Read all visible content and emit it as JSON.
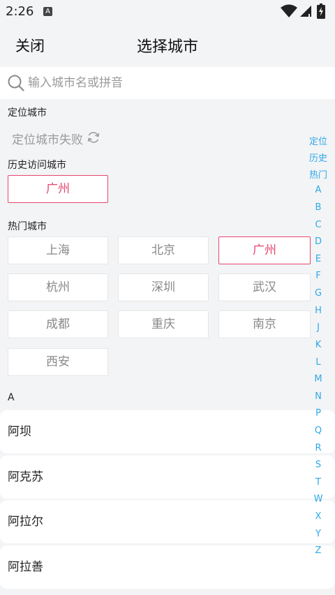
{
  "status": {
    "time": "2:26",
    "app_icon": "A",
    "icons": [
      "wifi-icon",
      "signal-icon",
      "battery-icon"
    ]
  },
  "nav": {
    "close_label": "关闭",
    "title": "选择城市"
  },
  "search": {
    "placeholder": "输入城市名或拼音",
    "value": ""
  },
  "location": {
    "label": "定位城市",
    "status_text": "定位城市失败"
  },
  "history": {
    "label": "历史访问城市",
    "cities": [
      "广州"
    ]
  },
  "hot": {
    "label": "热门城市",
    "cities": [
      "上海",
      "北京",
      "广州",
      "杭州",
      "深圳",
      "武汉",
      "成都",
      "重庆",
      "南京",
      "西安"
    ],
    "selected": "广州"
  },
  "list": {
    "header": "A",
    "items": [
      "阿坝",
      "阿克苏",
      "阿拉尔",
      "阿拉善"
    ]
  },
  "index_bar": [
    "定位",
    "历史",
    "热门",
    "A",
    "B",
    "C",
    "D",
    "E",
    "F",
    "G",
    "H",
    "J",
    "K",
    "L",
    "M",
    "N",
    "P",
    "Q",
    "R",
    "S",
    "T",
    "W",
    "X",
    "Y",
    "Z"
  ],
  "colors": {
    "accent": "#e5476e",
    "index": "#2fa8e8",
    "background": "#f3f4f6"
  }
}
